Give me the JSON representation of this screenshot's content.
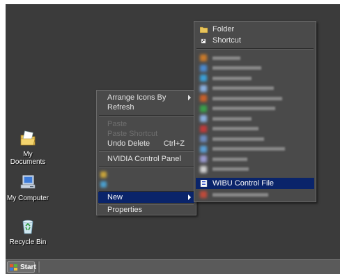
{
  "desktop": {
    "icons": [
      {
        "label": "My Documents"
      },
      {
        "label": "My Computer"
      },
      {
        "label": "Recycle Bin"
      }
    ]
  },
  "context_menu": {
    "arrange": "Arrange Icons By",
    "refresh": "Refresh",
    "paste": "Paste",
    "paste_shortcut": "Paste Shortcut",
    "undo": "Undo Delete",
    "undo_shortcut": "Ctrl+Z",
    "nvidia": "NVIDIA Control Panel",
    "new": "New",
    "properties": "Properties"
  },
  "new_submenu": {
    "folder": "Folder",
    "shortcut": "Shortcut",
    "wibu": "WIBU Control File"
  },
  "taskbar": {
    "start_label": "Start"
  },
  "colors": {
    "desktop_bg": "#3b3b3b",
    "menu_bg": "#4a4a4a",
    "highlight": "#0a246a"
  }
}
